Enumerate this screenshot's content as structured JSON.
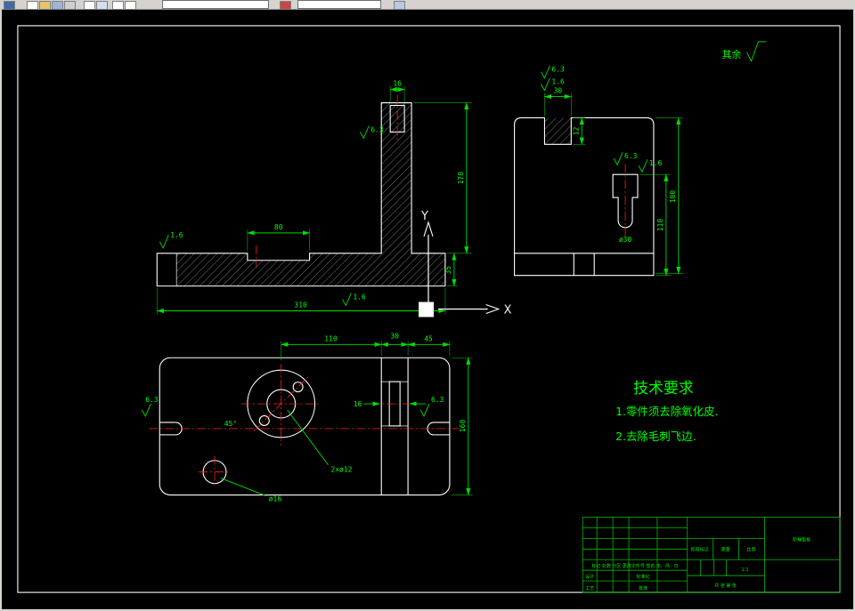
{
  "colors": {
    "background": "#000000",
    "geometry": "#ffffff",
    "dimension": "#00ff00",
    "centerline": "#ff2020",
    "toolbar": "#d6d3ce"
  },
  "toolbar": {
    "icons": [
      "app-icon",
      "new-document-icon",
      "open-folder-icon",
      "save-icon",
      "print-icon",
      "preview-icon",
      "properties-icon",
      "cut-icon",
      "copy-icon",
      "layer-dropdown",
      "color-control-icon",
      "linetype-dropdown",
      "tool-icon"
    ]
  },
  "surface_note": {
    "label": "其余"
  },
  "ucs": {
    "x_label": "X",
    "y_label": "Y"
  },
  "tech_requirements": {
    "title": "技术要求",
    "item1": "1.零件须去除氧化皮.",
    "item2": "2.去除毛刺飞边."
  },
  "dims": {
    "front": {
      "hole_width": "16",
      "groove_width": "80",
      "overall_width": "310",
      "height": "170",
      "thickness": "35",
      "finish_top_left": "1.6",
      "finish_bottom": "1.6",
      "finish_col": "6.3"
    },
    "side": {
      "slot_width": "30",
      "slot_depth": "12",
      "finish_a": "6.3",
      "finish_b": "1.6",
      "bore_dia": "ø30",
      "bore_finish": "6.3",
      "bore_finish2": "1.6",
      "inner_height": "110",
      "overall_height": "180"
    },
    "plan": {
      "top_left": "110",
      "top_mid": "30",
      "top_right": "45",
      "right_height": "160",
      "angle": "45°",
      "strip": "16",
      "hole_label": "ø16",
      "bolt_label": "2×ø12",
      "finish_left": "6.3",
      "finish_right": "6.3"
    }
  },
  "title_block": {
    "part_name": "阶梯垫板",
    "header_cells": "标记 处数 分区 更改文件号 签名 年、月、日",
    "design": "设计",
    "standard": "标准化",
    "craft": "工艺",
    "approve": "批准",
    "stage_label": "阶段标记",
    "weight_label": "质量",
    "scale_label": "比例",
    "scale_value": "1:1",
    "sheet_info": "共 张 第 张"
  }
}
